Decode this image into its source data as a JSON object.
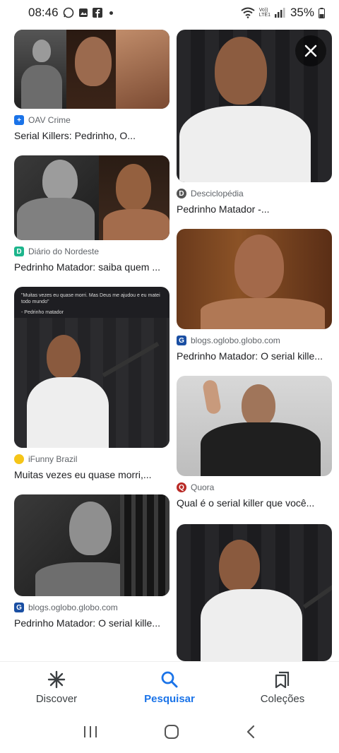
{
  "status_bar": {
    "time": "08:46",
    "battery": "35%",
    "network": "LTE1"
  },
  "results": [
    {
      "source": "OAV Crime",
      "title": "Serial Killers: Pedrinho, O...",
      "source_icon": "plus-icon",
      "icon_color": "#1a73e8"
    },
    {
      "source": "Desciclopédia",
      "title": "Pedrinho Matador -...",
      "source_icon": "d-icon",
      "icon_color": "#555555"
    },
    {
      "source": "Diário do Nordeste",
      "title": "Pedrinho Matador: saiba quem ...",
      "source_icon": "d-icon",
      "icon_color": "#1db58c"
    },
    {
      "source": "blogs.oglobo.globo.com",
      "title": "Pedrinho Matador: O serial kille...",
      "source_icon": "g-icon",
      "icon_color": "#1a4fa3"
    },
    {
      "source": "iFunny Brazil",
      "title": "Muitas vezes eu quase morri,...",
      "source_icon": "smile-icon",
      "icon_color": "#f5c518"
    },
    {
      "source": "Quora",
      "title": "Qual é o serial killer que você...",
      "source_icon": "q-icon",
      "icon_color": "#b92b27"
    },
    {
      "source": "blogs.oglobo.globo.com",
      "title": "Pedrinho Matador: O serial kille...",
      "source_icon": "g-icon",
      "icon_color": "#1a4fa3"
    }
  ],
  "quote": {
    "text": "\"Muitas vezes eu quase morri. Mas Deus me ajudou e eu matei todo mundo\"",
    "author": "- Pedrinho matador"
  },
  "bottom_nav": {
    "discover": "Discover",
    "search": "Pesquisar",
    "collections": "Coleções"
  },
  "colors": {
    "accent": "#1a73e8"
  }
}
